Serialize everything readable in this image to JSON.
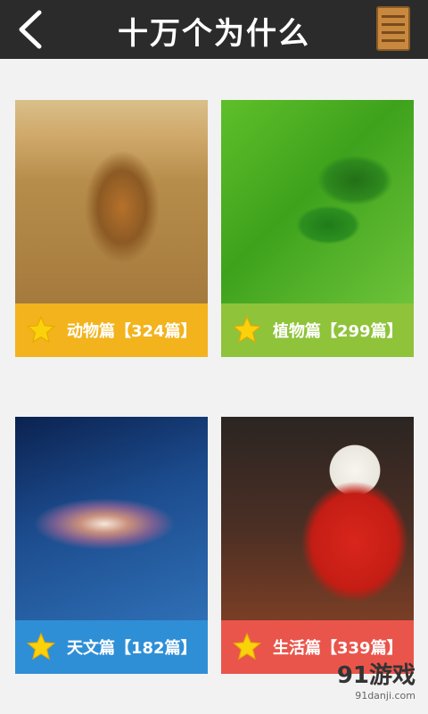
{
  "header": {
    "back_icon": "back-chevron-icon",
    "title": "十万个为什么",
    "menu_icon": "bookshelf-icon"
  },
  "categories": [
    {
      "label": "动物篇【324篇】",
      "icon": "star-icon",
      "color": "#f2b31d",
      "image": "lion-photo"
    },
    {
      "label": "植物篇【299篇】",
      "icon": "star-icon",
      "color": "#8fc33a",
      "image": "leaves-photo"
    },
    {
      "label": "天文篇【182篇】",
      "icon": "star-icon",
      "color": "#2f8fd6",
      "image": "galaxy-photo"
    },
    {
      "label": "生活篇【339篇】",
      "icon": "star-icon",
      "color": "#e9554b",
      "image": "snowman-photo"
    }
  ],
  "watermark": {
    "logo": "91游戏",
    "site": "91danji.com"
  }
}
